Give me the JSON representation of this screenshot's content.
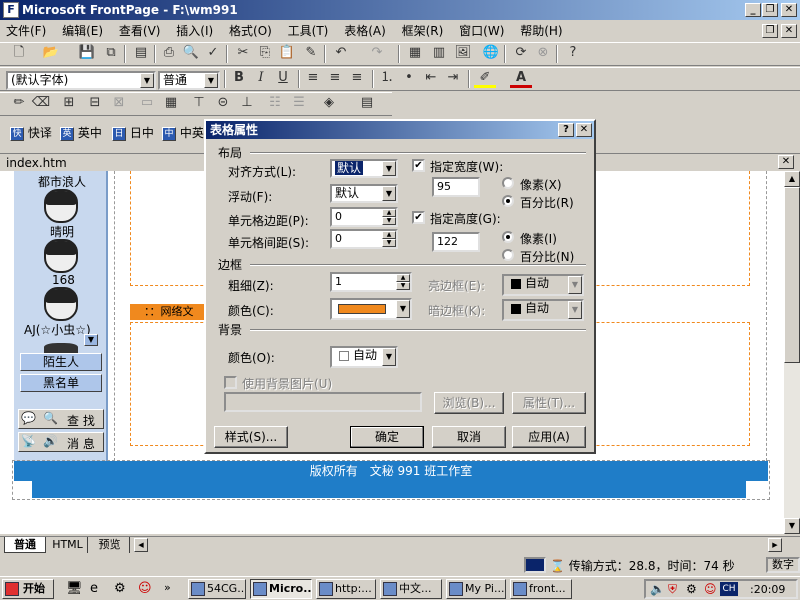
{
  "window": {
    "title": "Microsoft FrontPage - F:\\wm991",
    "icon": "frontpage-icon"
  },
  "menu": [
    "文件(F)",
    "编辑(E)",
    "查看(V)",
    "插入(I)",
    "格式(O)",
    "工具(T)",
    "表格(A)",
    "框架(R)",
    "窗口(W)",
    "帮助(H)"
  ],
  "format_toolbar": {
    "font": "(默认字体)",
    "style": "普通",
    "bold": "B",
    "italic": "I",
    "underline": "U"
  },
  "ime_bar": {
    "items": [
      "快译",
      "英中",
      "日中",
      "中英"
    ]
  },
  "doc_tab": "index.htm",
  "sidebar": {
    "users": [
      "都市浪人",
      "晴明",
      "168",
      "AJ(☆小虫☆)"
    ],
    "buttons": [
      "陌生人",
      "黑名单"
    ],
    "tools": [
      "查 找",
      "消 息"
    ]
  },
  "page": {
    "banner_text": "：：网络文",
    "footer": "版权所有　文秘 991 班工作室"
  },
  "dialog": {
    "title": "表格属性",
    "help": "?",
    "close": "✕",
    "layout_group": "布局",
    "align_label": "对齐方式(L):",
    "align_value": "默认",
    "float_label": "浮动(F):",
    "float_value": "默认",
    "padding_label": "单元格边距(P):",
    "padding_value": "0",
    "spacing_label": "单元格间距(S):",
    "spacing_value": "0",
    "width_check": "指定宽度(W):",
    "width_value": "95",
    "width_px": "像素(X)",
    "width_pct": "百分比(R)",
    "height_check": "指定高度(G):",
    "height_value": "122",
    "height_px": "像素(I)",
    "height_pct": "百分比(N)",
    "border_group": "边框",
    "size_label": "粗细(Z):",
    "size_value": "1",
    "color_label": "颜色(C):",
    "border_color": "#f0891e",
    "light_label": "亮边框(E):",
    "light_value": "自动",
    "dark_label": "暗边框(K):",
    "dark_value": "自动",
    "bg_group": "背景",
    "bg_color_label": "颜色(O):",
    "bg_color_value": "自动",
    "bg_image_check": "使用背景图片(U)",
    "browse": "浏览(B)...",
    "props": "属性(T)...",
    "style_btn": "样式(S)...",
    "ok": "确定",
    "cancel": "取消",
    "apply": "应用(A)"
  },
  "view_tabs": [
    "普通",
    "HTML",
    "预览"
  ],
  "statusbar": {
    "transfer": "传输方式：28.8，时间：74 秒",
    "mode": "数字"
  },
  "taskbar": {
    "start": "开始",
    "tasks": [
      "54CG...",
      "Micro...",
      "http:...",
      "中文...",
      "My Pi...",
      "front..."
    ],
    "time": ":20:09",
    "ime": "CH"
  },
  "colors": {
    "accent_orange": "#f0891e",
    "page_blue": "#1f7dc8",
    "title_blue": "#0a246a"
  }
}
